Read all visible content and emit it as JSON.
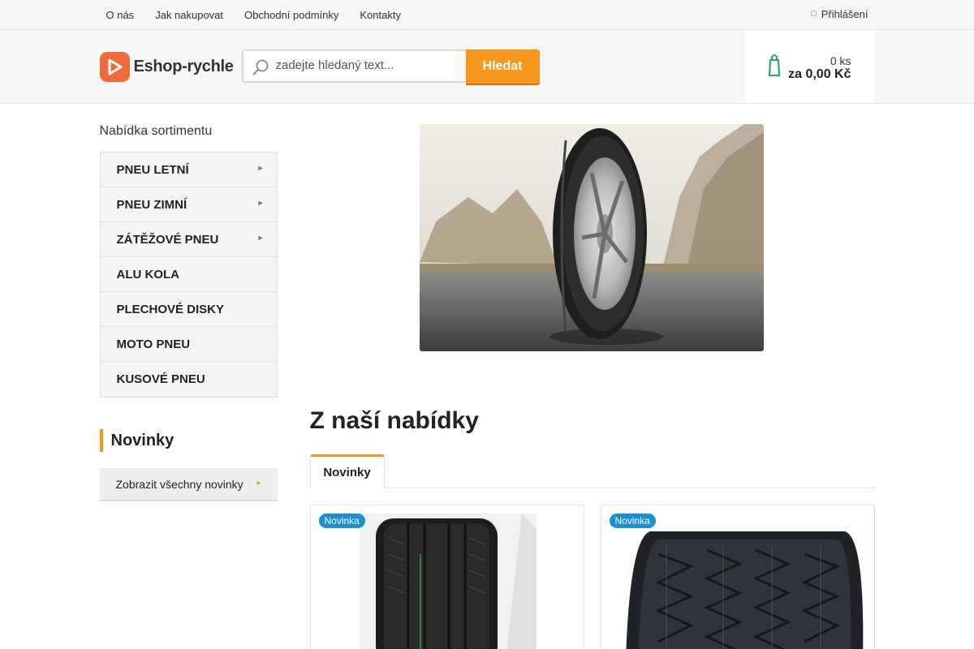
{
  "topnav": {
    "links": [
      "O nás",
      "Jak nakupovat",
      "Obchodní podmínky",
      "Kontakty"
    ],
    "login_label": "Přihlášení"
  },
  "header": {
    "logo_text": "Eshop-rychle",
    "search_placeholder": "zadejte hledaný text...",
    "search_button": "Hledat",
    "cart_count": "0 ks",
    "cart_total": "za 0,00 Kč"
  },
  "sidebar": {
    "title": "Nabídka sortimentu",
    "items": [
      {
        "label": "PNEU LETNÍ",
        "has_submenu": true
      },
      {
        "label": "PNEU ZIMNÍ",
        "has_submenu": true
      },
      {
        "label": "ZÁTĚŽOVÉ PNEU",
        "has_submenu": true
      },
      {
        "label": "ALU KOLA",
        "has_submenu": false
      },
      {
        "label": "PLECHOVÉ DISKY",
        "has_submenu": false
      },
      {
        "label": "MOTO PNEU",
        "has_submenu": false
      },
      {
        "label": "KUSOVÉ PNEU",
        "has_submenu": false
      }
    ],
    "news_title": "Novinky",
    "news_all": "Zobrazit všechny novinky"
  },
  "main": {
    "section_title": "Z naší nabídky",
    "tab_active": "Novinky",
    "products": [
      {
        "badge": "Novinka"
      },
      {
        "badge": "Novinka"
      }
    ]
  },
  "colors": {
    "accent": "#f7951d",
    "logo": "#f06a3a",
    "badge": "#1a8fd6",
    "cart_icon": "#27ae60"
  }
}
